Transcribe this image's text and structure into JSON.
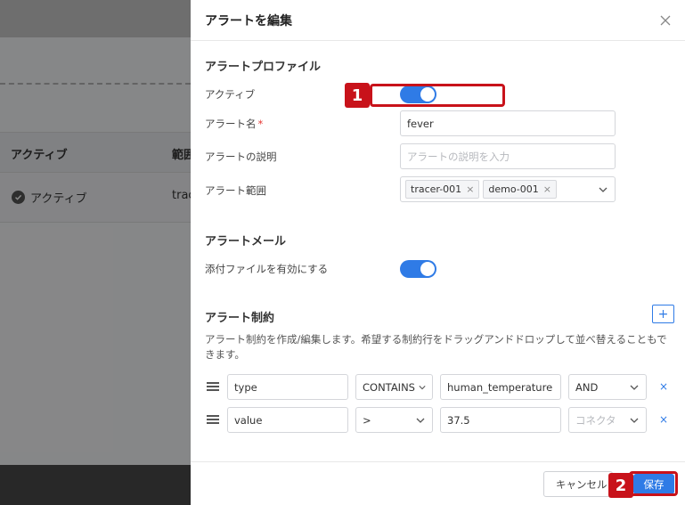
{
  "background": {
    "table_headers": [
      "アクティブ",
      "範囲"
    ],
    "row_status": "アクティブ",
    "row_range": "trac"
  },
  "modal": {
    "title": "アラートを編集",
    "profile": {
      "section_title": "アラートプロファイル",
      "active_label": "アクティブ",
      "active_on": true,
      "name_label": "アラート名",
      "name_required_mark": "*",
      "name_value": "fever",
      "desc_label": "アラートの説明",
      "desc_placeholder": "アラートの説明を入力",
      "scope_label": "アラート範囲",
      "scope_tags": [
        "tracer-001",
        "demo-001"
      ],
      "tag_remove": "×"
    },
    "mail": {
      "section_title": "アラートメール",
      "attach_label": "添付ファイルを有効にする",
      "attach_on": true
    },
    "constraints": {
      "section_title": "アラート制約",
      "add_label": "+",
      "description": "アラート制約を作成/編集します。希望する制約行をドラッグアンドドロップして並べ替えることもできます。",
      "delete_label": "×",
      "rows": [
        {
          "field": "type",
          "operator": "CONTAINS",
          "value": "human_temperature",
          "connector": "AND",
          "connector_is_placeholder": false
        },
        {
          "field": "value",
          "operator": ">",
          "value": "37.5",
          "connector": "コネクタ",
          "connector_is_placeholder": true
        }
      ]
    },
    "footer": {
      "cancel_label": "キャンセル",
      "save_label": "保存"
    }
  },
  "annotations": {
    "marker_1": "1",
    "marker_2": "2"
  },
  "colors": {
    "accent": "#2f7be6",
    "annotation": "#c8121a"
  }
}
